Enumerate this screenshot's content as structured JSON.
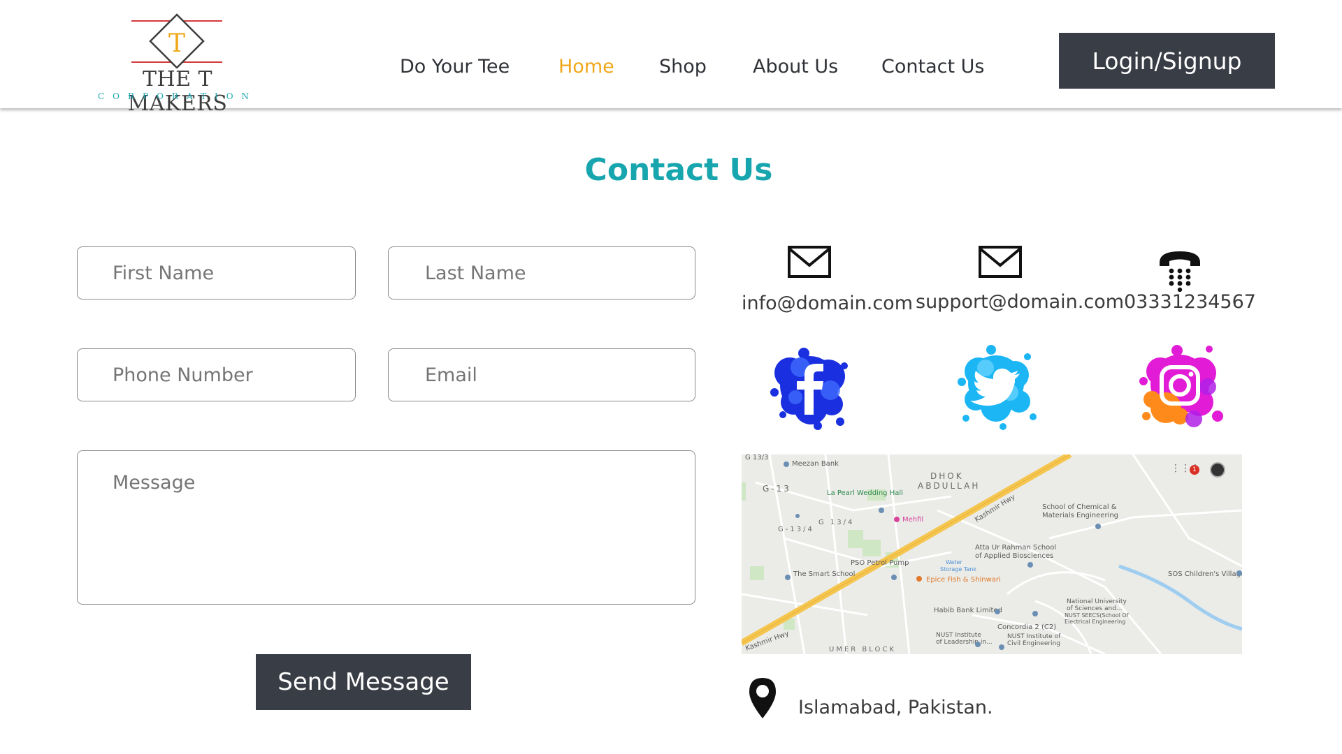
{
  "brand": {
    "name": "THE T MAKERS",
    "tagline": "CORPORATION",
    "letter": "T"
  },
  "nav": {
    "items": [
      {
        "label": "Do Your Tee",
        "active": false
      },
      {
        "label": "Home",
        "active": true
      },
      {
        "label": "Shop",
        "active": false
      },
      {
        "label": "About Us",
        "active": false
      },
      {
        "label": "Contact Us",
        "active": false
      }
    ],
    "login_label": "Login/Signup"
  },
  "page": {
    "title": "Contact Us"
  },
  "form": {
    "first_name_placeholder": "First Name",
    "last_name_placeholder": "Last Name",
    "phone_placeholder": "Phone Number",
    "email_placeholder": "Email",
    "message_placeholder": "Message",
    "submit_label": "Send Message"
  },
  "contact": {
    "email_info": "info@domain.com",
    "email_support": "support@domain.com",
    "phone": "03331234567",
    "address": "Islamabad, Pakistan."
  },
  "social": [
    "facebook-icon",
    "twitter-icon",
    "instagram-icon"
  ],
  "map": {
    "labels": {
      "g133": "G 13/3",
      "meezan": "Meezan Bank",
      "g13": "G-13",
      "dhok": "DHOK",
      "abdullah": "ABDULLAH",
      "lapearl": "La Pearl Wedding Hall",
      "g134a": "G 13/4",
      "g134b": "G-13/4",
      "mehfil": "Mehfil",
      "kashmir1": "Kashmir Hwy",
      "kashmir2": "Kashmir Hwy",
      "school_chem": "School of Chemical &",
      "materials": "Materials Engineering",
      "atta": "Atta Ur Rahman School",
      "applied": "of Applied Biosciences",
      "pso": "PSO Petrol Pump",
      "water": "Water",
      "storage": "Storage Tank",
      "smart": "The Smart School",
      "epice": "Epice Fish & Shinwari",
      "sos": "SOS Children's Village",
      "habib": "Habib Bank Limited",
      "nust1": "National University",
      "nust2": "of Sciences and...",
      "nust3": "NUST SEECS(School Of",
      "nust4": "Electrical Engineering",
      "concordia": "Concordia 2 (C2)",
      "nust_inst": "NUST Institute",
      "leadership": "of Leadership in...",
      "civil_inst": "NUST Institute of",
      "civil": "Civil Engineering",
      "umer": "UMER BLOCK",
      "notif": "1"
    }
  },
  "colors": {
    "accent": "#17a5ae",
    "active_nav": "#f0a81a",
    "button": "#393d45",
    "road": "#f5c64f"
  }
}
